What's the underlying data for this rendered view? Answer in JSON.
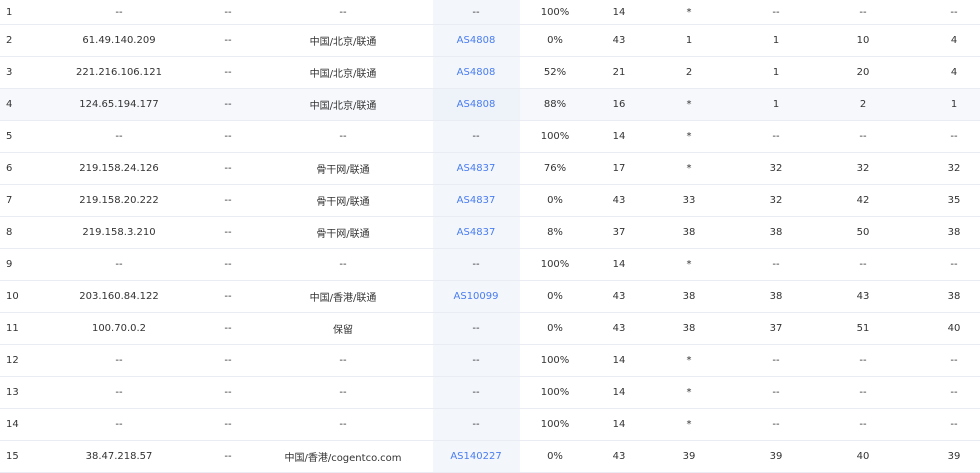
{
  "rows": [
    {
      "hop": "1",
      "ip": "--",
      "host": "--",
      "location": "--",
      "asn": "--",
      "loss": "100%",
      "sent": "14",
      "last": "*",
      "avg": "--",
      "best": "--",
      "worst": "--"
    },
    {
      "hop": "2",
      "ip": "61.49.140.209",
      "host": "--",
      "location": "中国/北京/联通",
      "asn": "AS4808",
      "loss": "0%",
      "sent": "43",
      "last": "1",
      "avg": "1",
      "best": "10",
      "worst": "4"
    },
    {
      "hop": "3",
      "ip": "221.216.106.121",
      "host": "--",
      "location": "中国/北京/联通",
      "asn": "AS4808",
      "loss": "52%",
      "sent": "21",
      "last": "2",
      "avg": "1",
      "best": "20",
      "worst": "4"
    },
    {
      "hop": "4",
      "ip": "124.65.194.177",
      "host": "--",
      "location": "中国/北京/联通",
      "asn": "AS4808",
      "loss": "88%",
      "sent": "16",
      "last": "*",
      "avg": "1",
      "best": "2",
      "worst": "1"
    },
    {
      "hop": "5",
      "ip": "--",
      "host": "--",
      "location": "--",
      "asn": "--",
      "loss": "100%",
      "sent": "14",
      "last": "*",
      "avg": "--",
      "best": "--",
      "worst": "--"
    },
    {
      "hop": "6",
      "ip": "219.158.24.126",
      "host": "--",
      "location": "骨干网/联通",
      "asn": "AS4837",
      "loss": "76%",
      "sent": "17",
      "last": "*",
      "avg": "32",
      "best": "32",
      "worst": "32"
    },
    {
      "hop": "7",
      "ip": "219.158.20.222",
      "host": "--",
      "location": "骨干网/联通",
      "asn": "AS4837",
      "loss": "0%",
      "sent": "43",
      "last": "33",
      "avg": "32",
      "best": "42",
      "worst": "35"
    },
    {
      "hop": "8",
      "ip": "219.158.3.210",
      "host": "--",
      "location": "骨干网/联通",
      "asn": "AS4837",
      "loss": "8%",
      "sent": "37",
      "last": "38",
      "avg": "38",
      "best": "50",
      "worst": "38"
    },
    {
      "hop": "9",
      "ip": "--",
      "host": "--",
      "location": "--",
      "asn": "--",
      "loss": "100%",
      "sent": "14",
      "last": "*",
      "avg": "--",
      "best": "--",
      "worst": "--"
    },
    {
      "hop": "10",
      "ip": "203.160.84.122",
      "host": "--",
      "location": "中国/香港/联通",
      "asn": "AS10099",
      "loss": "0%",
      "sent": "43",
      "last": "38",
      "avg": "38",
      "best": "43",
      "worst": "38"
    },
    {
      "hop": "11",
      "ip": "100.70.0.2",
      "host": "--",
      "location": "保留",
      "asn": "--",
      "loss": "0%",
      "sent": "43",
      "last": "38",
      "avg": "37",
      "best": "51",
      "worst": "40"
    },
    {
      "hop": "12",
      "ip": "--",
      "host": "--",
      "location": "--",
      "asn": "--",
      "loss": "100%",
      "sent": "14",
      "last": "*",
      "avg": "--",
      "best": "--",
      "worst": "--"
    },
    {
      "hop": "13",
      "ip": "--",
      "host": "--",
      "location": "--",
      "asn": "--",
      "loss": "100%",
      "sent": "14",
      "last": "*",
      "avg": "--",
      "best": "--",
      "worst": "--"
    },
    {
      "hop": "14",
      "ip": "--",
      "host": "--",
      "location": "--",
      "asn": "--",
      "loss": "100%",
      "sent": "14",
      "last": "*",
      "avg": "--",
      "best": "--",
      "worst": "--"
    },
    {
      "hop": "15",
      "ip": "38.47.218.57",
      "host": "--",
      "location": "中国/香港/cogentco.com",
      "asn": "AS140227",
      "loss": "0%",
      "sent": "43",
      "last": "39",
      "avg": "39",
      "best": "40",
      "worst": "39"
    }
  ],
  "hover_row_index": 3,
  "colors": {
    "link": "#4a7df0",
    "text": "#333333",
    "divider": "#e9edf3",
    "as_column_bg": "#f3f6fb",
    "hover_bg": "#f6f8fc"
  }
}
